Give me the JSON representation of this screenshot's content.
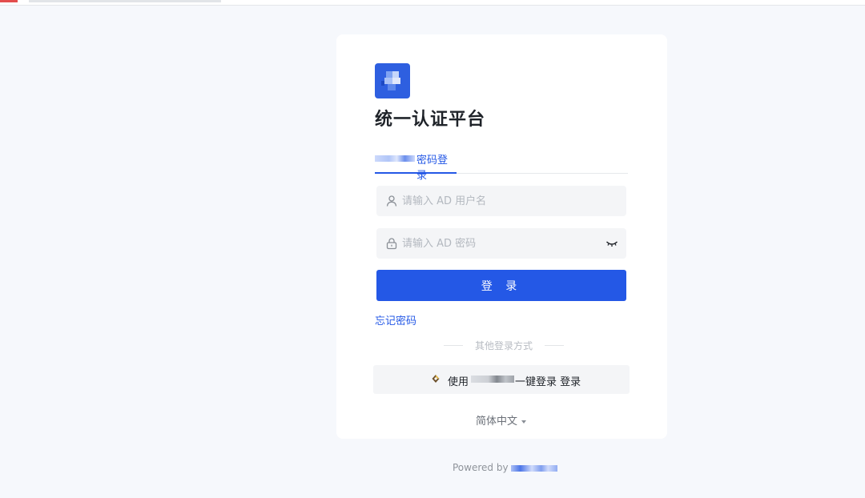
{
  "app": {
    "title": "统一认证平台"
  },
  "tabs": [
    {
      "label": "密码登录",
      "active": true
    }
  ],
  "login_form": {
    "username_placeholder": "请输入 AD 用户名",
    "username_value": "",
    "password_placeholder": "请输入 AD 密码",
    "password_value": "",
    "submit_label": "登 录",
    "forgot_label": "忘记密码"
  },
  "other_login": {
    "divider_label": "其他登录方式",
    "sso_prefix": "使用",
    "sso_suffix": "一键登录 登录"
  },
  "language": {
    "selected": "简体中文"
  },
  "footer": {
    "powered_by": "Powered by"
  },
  "icons": {
    "username": "user-icon",
    "password": "lock-icon",
    "toggle_visibility": "eye-closed-icon",
    "sso": "sso-icon",
    "language_caret": "caret-down-icon"
  },
  "colors": {
    "accent": "#2458e6",
    "page_background": "#f6f8fc",
    "input_background": "#f4f5f7",
    "placeholder": "#b3b8bf"
  }
}
